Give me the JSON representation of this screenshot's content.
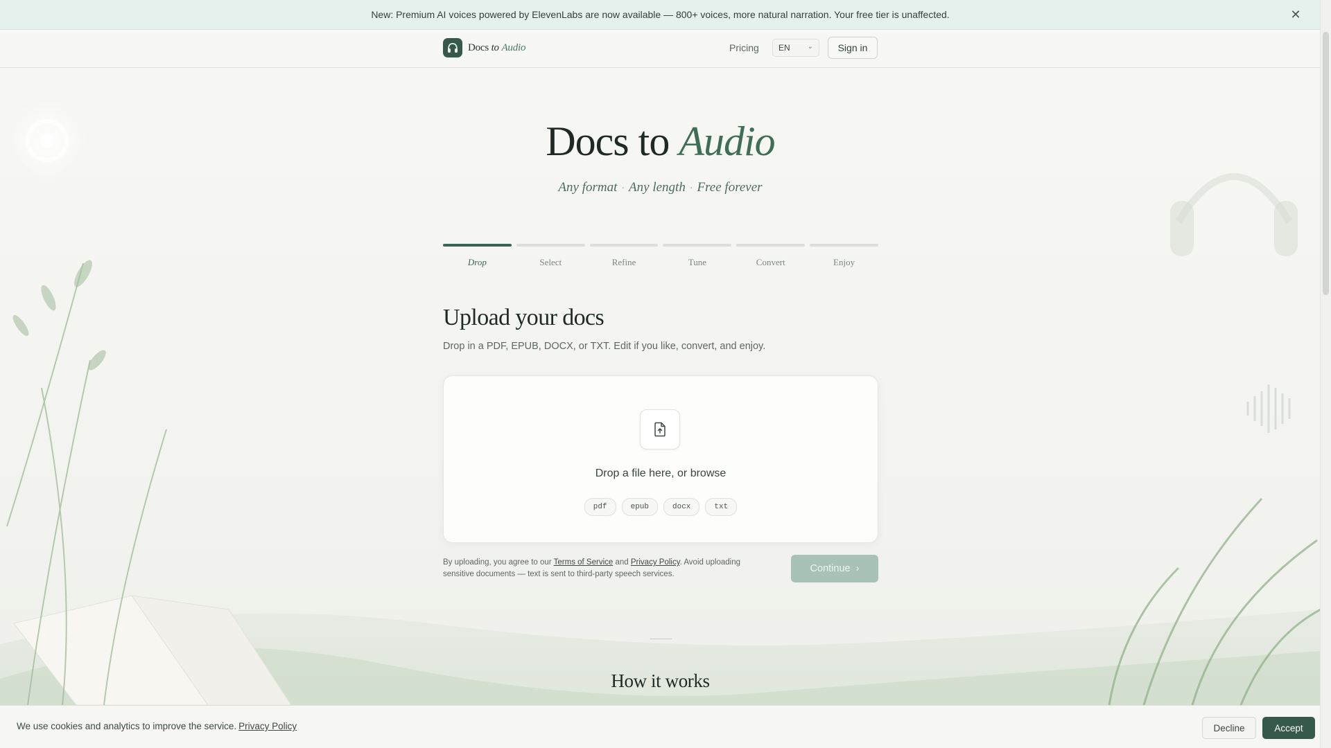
{
  "banner": {
    "text": "New: Premium AI voices powered by ElevenLabs are now available — 800+ voices, more natural narration. Your free tier is unaffected.",
    "close_glyph": "✕"
  },
  "header": {
    "logo_docs": "Docs",
    "logo_to": "to",
    "logo_audio": "Audio",
    "pricing": "Pricing",
    "language": "EN",
    "sign_in": "Sign in"
  },
  "hero": {
    "title_main": "Docs to",
    "title_accent": "Audio",
    "tagline": [
      "Any format",
      "Any length",
      "Free forever"
    ],
    "separator": "·"
  },
  "stepper": {
    "steps": [
      "Drop",
      "Select",
      "Refine",
      "Tune",
      "Convert",
      "Enjoy"
    ],
    "active_index": 0
  },
  "upload": {
    "title": "Upload your docs",
    "description": "Drop in a PDF, EPUB, DOCX, or TXT. Edit if you like, convert, and enjoy.",
    "drop_text": "Drop a file here, or browse",
    "formats": [
      "pdf",
      "epub",
      "docx",
      "txt"
    ],
    "legal_prefix": "By uploading, you agree to our",
    "terms_link": "Terms of Service",
    "legal_and": "and",
    "privacy_link": "Privacy Policy",
    "legal_suffix": ". Avoid uploading sensitive documents — text is sent to third-party speech services.",
    "continue": "Continue",
    "continue_glyph": "›"
  },
  "how_it_works": {
    "title": "How it works"
  },
  "cookie": {
    "text": "We use cookies and analytics to improve the service.",
    "privacy_link": "Privacy Policy",
    "decline": "Decline",
    "accept": "Accept"
  },
  "colors": {
    "accent": "#3b6653",
    "banner_bg": "#e4f1ec",
    "accept_bg": "#35594a",
    "continue_disabled": "#a9c2b6"
  }
}
